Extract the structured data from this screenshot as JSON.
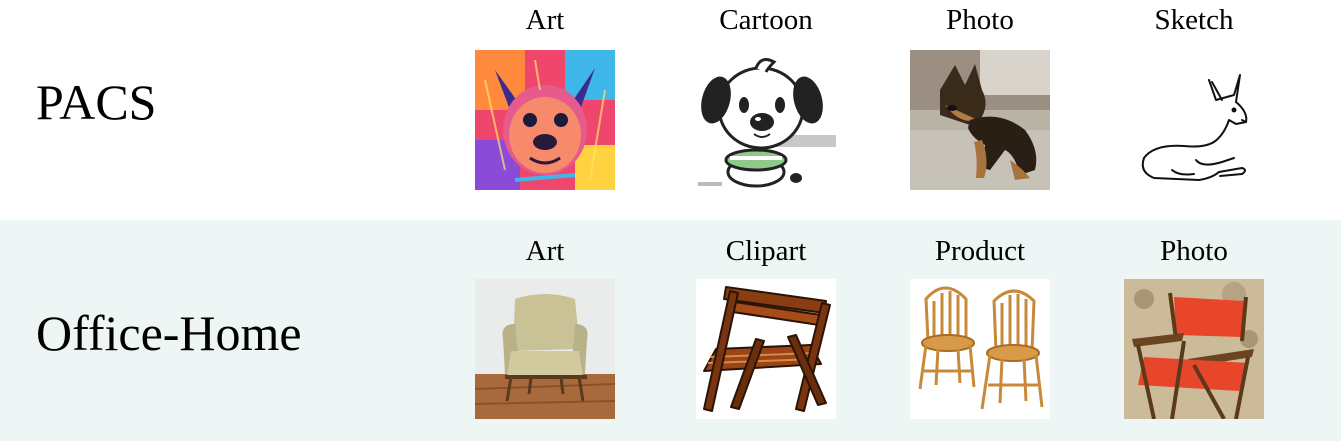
{
  "rows": [
    {
      "title": "PACS",
      "domains": [
        {
          "label": "Art",
          "image": "colorful-bulldog-painting"
        },
        {
          "label": "Cartoon",
          "image": "cartoon-puppy"
        },
        {
          "label": "Photo",
          "image": "german-shepherd-photo"
        },
        {
          "label": "Sketch",
          "image": "dog-line-sketch"
        }
      ]
    },
    {
      "title": "Office-Home",
      "domains": [
        {
          "label": "Art",
          "image": "armchair-photo"
        },
        {
          "label": "Clipart",
          "image": "folding-chair-clipart"
        },
        {
          "label": "Product",
          "image": "wooden-chairs-product"
        },
        {
          "label": "Photo",
          "image": "red-directors-chair-photo"
        }
      ]
    }
  ],
  "colors": {
    "page_background": "#ffffff",
    "second_row_background": "#eef6f5"
  }
}
